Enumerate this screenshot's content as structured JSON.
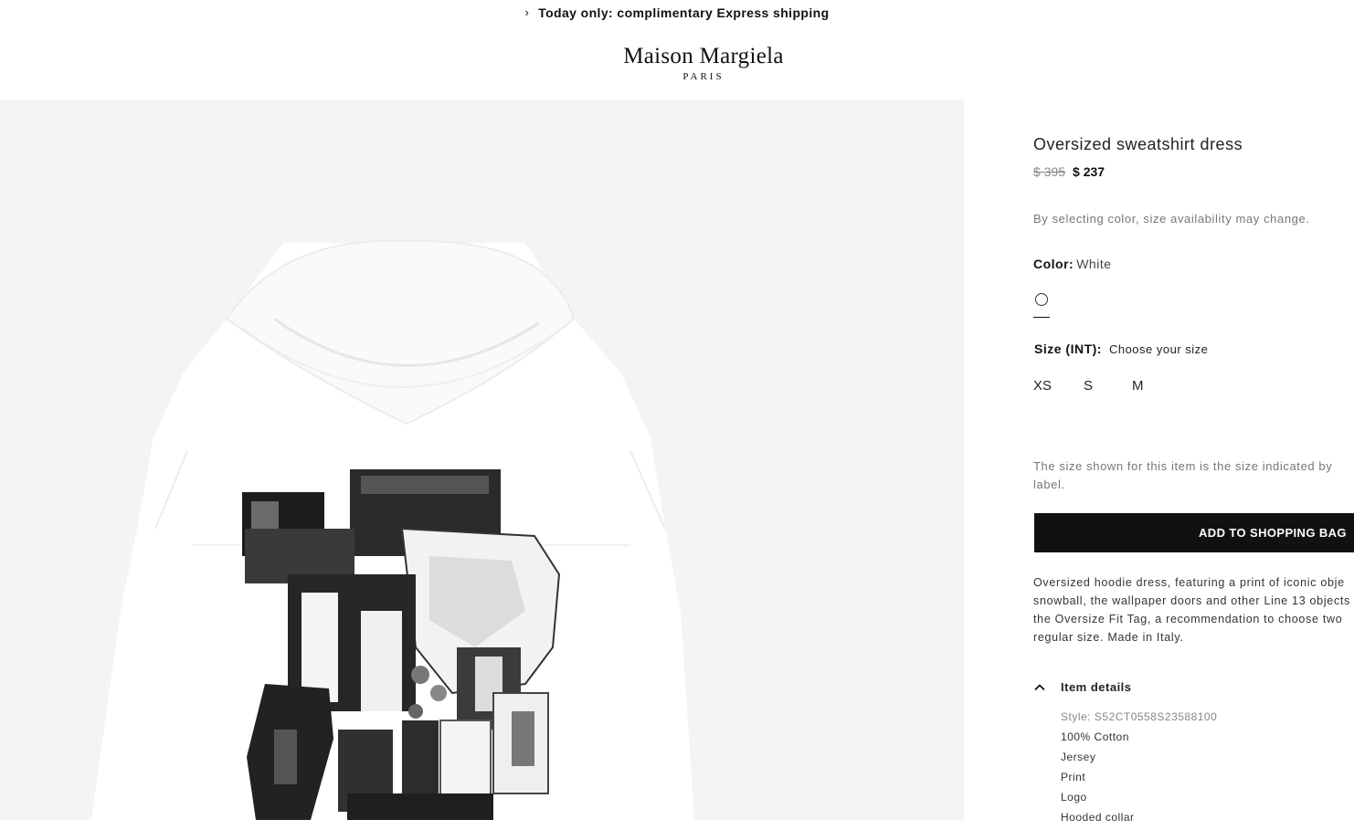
{
  "promo": {
    "text": "Today only: complimentary Express shipping"
  },
  "brand": {
    "name": "Maison Margiela",
    "city": "PARIS"
  },
  "product": {
    "title": "Oversized sweatshirt dress",
    "price_original": "$ 395",
    "price_sale": "$ 237",
    "selection_note": "By selecting color, size availability may change.",
    "color_label": "Color:",
    "color_value": "White",
    "color_swatch": "#ffffff",
    "size_label": "Size (INT):",
    "size_prompt": "Choose your size",
    "sizes": [
      "XS",
      "S",
      "M"
    ],
    "size_note_line1": "The size shown for this item is the size indicated by",
    "size_note_line2": "label.",
    "add_to_bag": "ADD TO SHOPPING BAG",
    "description_lines": [
      "Oversized hoodie dress, featuring a print of iconic obje",
      "snowball, the wallpaper doors and other Line 13 objects",
      "the Oversize Fit Tag, a recommendation to choose two",
      "regular size. Made in Italy."
    ],
    "details_title": "Item details",
    "details": [
      "Style: S52CT0558S23588100",
      "100% Cotton",
      "Jersey",
      "Print",
      "Logo",
      "Hooded collar"
    ]
  },
  "colors": {
    "button_bg": "#111111",
    "gallery_bg": "#f4f4f4"
  }
}
